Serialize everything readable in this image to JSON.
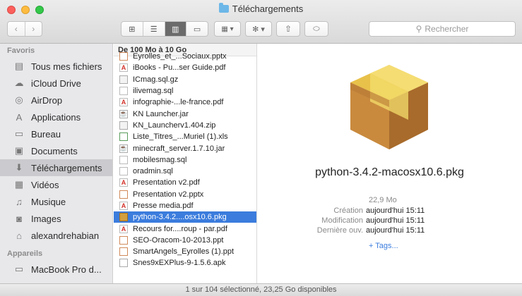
{
  "window": {
    "title": "Téléchargements",
    "status": "1 sur 104 sélectionné, 23,25 Go disponibles"
  },
  "toolbar": {
    "back": "‹",
    "forward": "›",
    "search_placeholder": "Rechercher",
    "view_icons": [
      "icon-view",
      "list-view",
      "column-view",
      "coverflow-view"
    ],
    "arrange_label": "▾",
    "action_label": "▾"
  },
  "sidebar": {
    "favorites_title": "Favoris",
    "favorites": [
      {
        "label": "Tous mes fichiers",
        "icon": "all-files-icon",
        "glyph": "▤"
      },
      {
        "label": "iCloud Drive",
        "icon": "cloud-icon",
        "glyph": "☁"
      },
      {
        "label": "AirDrop",
        "icon": "airdrop-icon",
        "glyph": "◎"
      },
      {
        "label": "Applications",
        "icon": "applications-icon",
        "glyph": "A"
      },
      {
        "label": "Bureau",
        "icon": "desktop-icon",
        "glyph": "▭"
      },
      {
        "label": "Documents",
        "icon": "documents-icon",
        "glyph": "▣"
      },
      {
        "label": "Téléchargements",
        "icon": "downloads-icon",
        "glyph": "⬇",
        "selected": true
      },
      {
        "label": "Vidéos",
        "icon": "videos-icon",
        "glyph": "▦"
      },
      {
        "label": "Musique",
        "icon": "music-icon",
        "glyph": "♫"
      },
      {
        "label": "Images",
        "icon": "images-icon",
        "glyph": "◙"
      },
      {
        "label": "alexandrehabian",
        "icon": "home-icon",
        "glyph": "⌂"
      }
    ],
    "devices_title": "Appareils",
    "devices": [
      {
        "label": "MacBook Pro d...",
        "icon": "laptop-icon",
        "glyph": "▭"
      }
    ]
  },
  "column": {
    "header": "De 100 Mo à 10 Go",
    "files": [
      {
        "name": "Eyrolles_et_...Sociaux.pptx",
        "type": "ppt",
        "partial": true
      },
      {
        "name": "iBooks - Pu...ser Guide.pdf",
        "type": "pdf"
      },
      {
        "name": "ICmag.sql.gz",
        "type": "zip"
      },
      {
        "name": "ilivemag.sql",
        "type": "doc"
      },
      {
        "name": "infographie-...le-france.pdf",
        "type": "pdf"
      },
      {
        "name": "KN Launcher.jar",
        "type": "jar"
      },
      {
        "name": "KN_Launcherv1.404.zip",
        "type": "zip"
      },
      {
        "name": "Liste_Titres_...Muriel (1).xls",
        "type": "xls"
      },
      {
        "name": "minecraft_server.1.7.10.jar",
        "type": "jar"
      },
      {
        "name": "mobilesmag.sql",
        "type": "doc"
      },
      {
        "name": "oradmin.sql",
        "type": "doc"
      },
      {
        "name": "Presentation v2.pdf",
        "type": "pdf"
      },
      {
        "name": "Presentation v2.pptx",
        "type": "ppt"
      },
      {
        "name": "Presse media.pdf",
        "type": "pdf"
      },
      {
        "name": "python-3.4.2....osx10.6.pkg",
        "type": "pkg",
        "selected": true
      },
      {
        "name": "Recours for....roup - par.pdf",
        "type": "pdf"
      },
      {
        "name": "SEO-Oracom-10-2013.ppt",
        "type": "ppt"
      },
      {
        "name": "SmartAngels_Eyrolles (1).ppt",
        "type": "ppt"
      },
      {
        "name": "Snes9xEXPlus-9-1.5.6.apk",
        "type": "apk"
      }
    ]
  },
  "preview": {
    "filename": "python-3.4.2-macosx10.6.pkg",
    "size": "22,9 Mo",
    "meta": [
      {
        "label": "Création",
        "value": "aujourd'hui 15:11"
      },
      {
        "label": "Modification",
        "value": "aujourd'hui 15:11"
      },
      {
        "label": "Dernière ouv.",
        "value": "aujourd'hui 15:11"
      }
    ],
    "tags": "+ Tags..."
  }
}
